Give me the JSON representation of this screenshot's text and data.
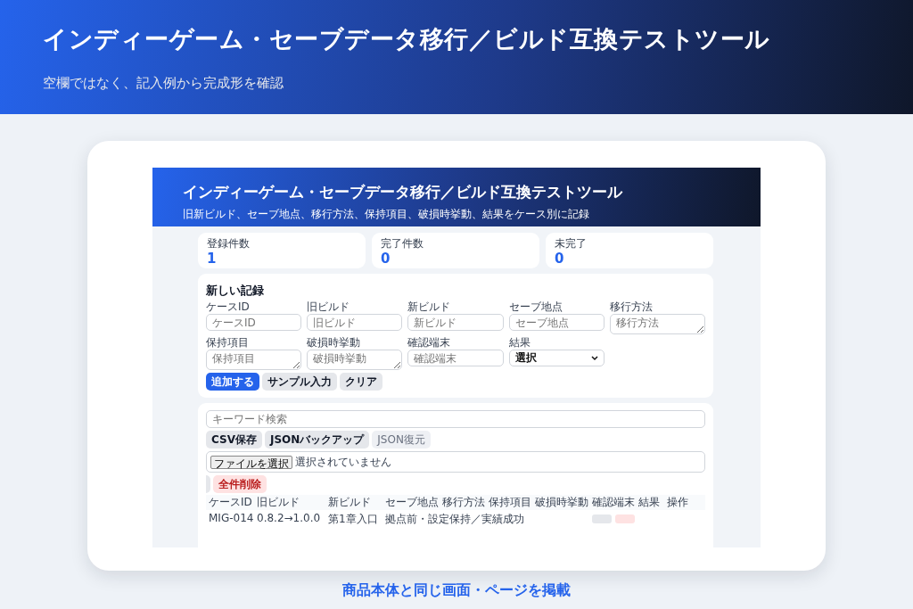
{
  "banner": {
    "title": "インディーゲーム・セーブデータ移行／ビルド互換テストツール",
    "subtitle": "空欄ではなく、記入例から完成形を確認"
  },
  "app": {
    "title": "インディーゲーム・セーブデータ移行／ビルド互換テストツール",
    "subtitle": "旧新ビルド、セーブ地点、移行方法、保持項目、破損時挙動、結果をケース別に記録"
  },
  "stats": [
    {
      "label": "登録件数",
      "value": "1"
    },
    {
      "label": "完了件数",
      "value": "0"
    },
    {
      "label": "未完了",
      "value": "0"
    }
  ],
  "form": {
    "heading": "新しい記録",
    "fields": [
      {
        "label": "ケースID",
        "placeholder": "ケースID",
        "kind": "input"
      },
      {
        "label": "旧ビルド",
        "placeholder": "旧ビルド",
        "kind": "input"
      },
      {
        "label": "新ビルド",
        "placeholder": "新ビルド",
        "kind": "input"
      },
      {
        "label": "セーブ地点",
        "placeholder": "セーブ地点",
        "kind": "input"
      },
      {
        "label": "移行方法",
        "placeholder": "移行方法",
        "kind": "textarea"
      },
      {
        "label": "保持項目",
        "placeholder": "保持項目",
        "kind": "textarea"
      },
      {
        "label": "破損時挙動",
        "placeholder": "破損時挙動",
        "kind": "textarea"
      },
      {
        "label": "確認端末",
        "placeholder": "確認端末",
        "kind": "input"
      },
      {
        "label": "結果",
        "value": "選択",
        "kind": "select"
      }
    ],
    "buttons": [
      {
        "label": "追加する",
        "kind": "primary"
      },
      {
        "label": "サンプル入力",
        "kind": "secondary"
      },
      {
        "label": "クリア",
        "kind": "secondary"
      }
    ]
  },
  "list": {
    "search_placeholder": "キーワード検索",
    "actions": [
      {
        "label": "CSV保存",
        "kind": "secondary"
      },
      {
        "label": "JSONバックアップ",
        "kind": "secondary"
      },
      {
        "label": "JSON復元",
        "kind": "muted"
      }
    ],
    "file_button": "ファイルを選択",
    "file_status": "選択されていません",
    "danger_button": "全件削除",
    "columns": [
      "ケースID",
      "旧ビルド",
      "新ビルド",
      "セーブ地点",
      "移行方法",
      "保持項目",
      "破損時挙動",
      "確認端末",
      "結果",
      "操作"
    ],
    "rows": [
      {
        "cells": [
          "MIG-014",
          "0.8.2→1.0.0",
          "第1章入口",
          "拠点前・設定保持／実績成功"
        ]
      }
    ]
  },
  "caption": "商品本体と同じ画面・ページを掲載"
}
